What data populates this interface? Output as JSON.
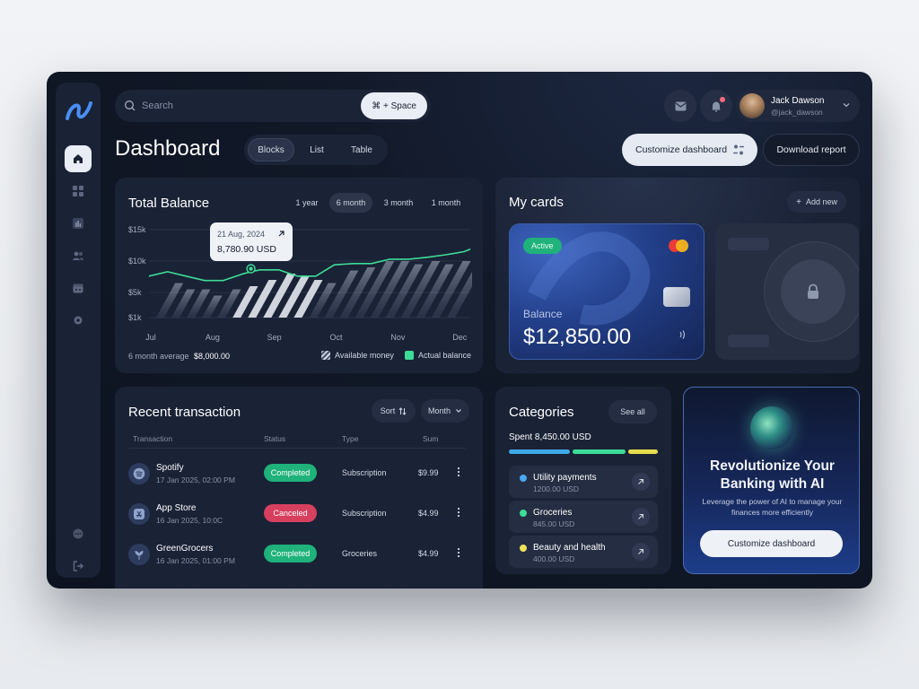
{
  "user": {
    "name": "Jack Dawson",
    "handle": "@jack_dawson"
  },
  "search": {
    "placeholder": "Search",
    "shortcut": "⌘ + Space"
  },
  "header": {
    "title": "Dashboard",
    "views": [
      "Blocks",
      "List",
      "Table"
    ],
    "active_view": "Blocks",
    "customize_label": "Customize dashboard",
    "download_label": "Download report"
  },
  "sidebar": {
    "items": [
      {
        "icon": "home-icon",
        "active": true
      },
      {
        "icon": "grid-icon",
        "active": false
      },
      {
        "icon": "chart-icon",
        "active": false
      },
      {
        "icon": "users-icon",
        "active": false
      },
      {
        "icon": "calendar-icon",
        "active": false
      },
      {
        "icon": "settings-icon",
        "active": false
      }
    ],
    "bottom": [
      "chat-icon",
      "logout-icon"
    ]
  },
  "balance": {
    "title": "Total Balance",
    "ranges": [
      "1 year",
      "6 month",
      "3 month",
      "1 month"
    ],
    "active_range": "6 month",
    "tooltip": {
      "date": "21 Aug, 2024",
      "value": "8,780.90 USD"
    },
    "avg_label": "6 month average",
    "avg_value": "$8,000.00",
    "legend": {
      "available": "Available money",
      "actual": "Actual balance"
    }
  },
  "chart_data": {
    "type": "line",
    "title": "Total Balance",
    "x_ticks": [
      "Jul",
      "Aug",
      "Sep",
      "Oct",
      "Nov",
      "Dec"
    ],
    "y_ticks": [
      "$15k",
      "$10k",
      "$5k",
      "$1k"
    ],
    "ylim": [
      1,
      15
    ],
    "series": [
      {
        "name": "Actual balance",
        "type": "line",
        "color": "#3ddc97",
        "x": [
          0,
          0.3,
          0.6,
          0.9,
          1.2,
          1.5,
          1.65,
          1.8,
          2.1,
          2.4,
          2.7,
          3.0,
          3.3,
          3.6,
          3.9,
          4.2,
          4.5,
          4.8,
          5.1,
          5.2
        ],
        "y": [
          7.6,
          8.3,
          7.6,
          6.9,
          6.9,
          7.9,
          8.3,
          8.6,
          8.6,
          7.6,
          7.6,
          9.4,
          9.6,
          9.6,
          10.3,
          10.3,
          10.6,
          11.0,
          11.5,
          11.9
        ]
      },
      {
        "name": "Available money",
        "type": "bars",
        "x": [
          0,
          0.25,
          0.5,
          0.75,
          1.0,
          1.25,
          1.5,
          1.75,
          2.0,
          2.25,
          2.5,
          2.75,
          3.0,
          3.25,
          3.5,
          3.75,
          4.0,
          4.25,
          4.5,
          4.75
        ],
        "y": [
          6.5,
          5.5,
          5.5,
          4.5,
          5.5,
          6.0,
          7.0,
          8.0,
          7.5,
          7.0,
          6.5,
          8.5,
          9.0,
          10.0,
          10.0,
          9.5,
          10.0,
          9.5,
          10.0,
          10.0
        ]
      }
    ],
    "highlight": {
      "x": 1.65,
      "y": 8.78
    }
  },
  "cards": {
    "title": "My cards",
    "add_label": "Add new",
    "card": {
      "status": "Active",
      "balance_label": "Balance",
      "balance": "$12,850.00"
    }
  },
  "transactions": {
    "title": "Recent transaction",
    "sort_label": "Sort",
    "period_label": "Month",
    "columns": [
      "Transaction",
      "Status",
      "Type",
      "Sum"
    ],
    "rows": [
      {
        "name": "Spotify",
        "date": "17 Jan 2025, 02:00 PM",
        "status": "Completed",
        "type": "Subscription",
        "sum": "$9.99",
        "icon": "spotify-icon",
        "status_color": "#1fb27a"
      },
      {
        "name": "App Store",
        "date": "16 Jan 2025, 10:0C",
        "status": "Canceled",
        "type": "Subscription",
        "sum": "$4.99",
        "icon": "app-store-icon",
        "status_color": "#d6405e"
      },
      {
        "name": "GreenGrocers",
        "date": "16 Jan 2025, 01:00 PM",
        "status": "Completed",
        "type": "Groceries",
        "sum": "$4.99",
        "icon": "grocery-icon",
        "status_color": "#1fb27a"
      }
    ]
  },
  "categories": {
    "title": "Categories",
    "see_all": "See all",
    "spent": "Spent 8,450.00 USD",
    "bar_colors": [
      "#3fa8e8",
      "#3ddc97",
      "#e6dd4c"
    ],
    "items": [
      {
        "name": "Utility payments",
        "amount": "1200.00 USD",
        "color": "#4aa8ef"
      },
      {
        "name": "Groceries",
        "amount": "845.00 USD",
        "color": "#3ddc97"
      },
      {
        "name": "Beauty and health",
        "amount": "400.00 USD",
        "color": "#f0e35a"
      }
    ]
  },
  "promo": {
    "title": "Revolutionize Your Banking with AI",
    "text": "Leverage the power of AI to manage your finances more efficiently",
    "button": "Customize dashboard"
  }
}
